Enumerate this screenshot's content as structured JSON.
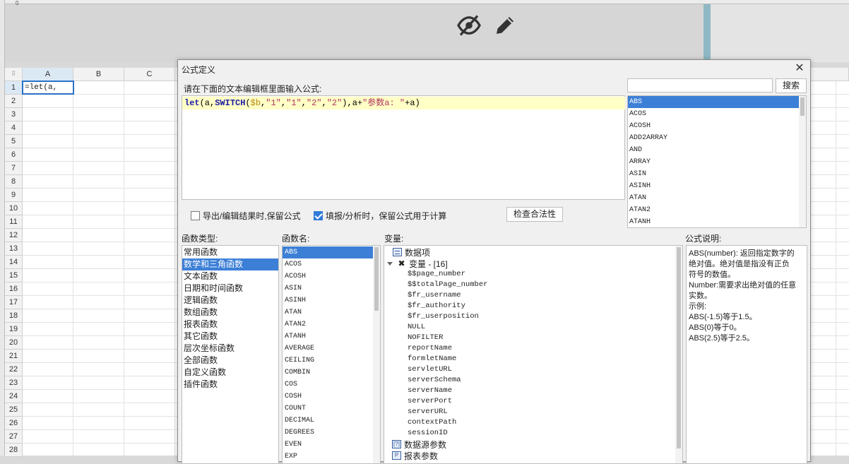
{
  "spreadsheet": {
    "columns": [
      "A",
      "B",
      "C"
    ],
    "rows": [
      "1",
      "2",
      "3",
      "4",
      "5",
      "6",
      "7",
      "8",
      "9",
      "10",
      "11",
      "12",
      "13",
      "14",
      "15",
      "16",
      "17",
      "18",
      "19",
      "20",
      "21",
      "22",
      "23",
      "24",
      "25",
      "26",
      "27",
      "28"
    ],
    "ruler_zero": "0",
    "cell_a1_value": "=let(a,"
  },
  "band_icons": [
    "eye-off-icon",
    "pencil-icon"
  ],
  "dialog": {
    "title": "公式定义",
    "prompt": "请在下面的文本编辑框里面输入公式:",
    "formula_tokens": [
      {
        "t": "let",
        "k": "kw"
      },
      {
        "t": "(a,",
        "k": "plain"
      },
      {
        "t": "SWITCH",
        "k": "kw"
      },
      {
        "t": "(",
        "k": "plain"
      },
      {
        "t": "$b",
        "k": "var"
      },
      {
        "t": ",",
        "k": "plain"
      },
      {
        "t": "\"1\"",
        "k": "str"
      },
      {
        "t": ",",
        "k": "plain"
      },
      {
        "t": "\"1\"",
        "k": "str"
      },
      {
        "t": ",",
        "k": "plain"
      },
      {
        "t": "\"2\"",
        "k": "str"
      },
      {
        "t": ",",
        "k": "plain"
      },
      {
        "t": "\"2\"",
        "k": "str"
      },
      {
        "t": "),a+",
        "k": "plain"
      },
      {
        "t": "\"参数a: \"",
        "k": "str"
      },
      {
        "t": "+a)",
        "k": "plain"
      }
    ],
    "search_placeholder": "",
    "search_button": "搜索",
    "top_function_list": [
      "ABS",
      "ACOS",
      "ACOSH",
      "ADD2ARRAY",
      "AND",
      "ARRAY",
      "ASIN",
      "ASINH",
      "ATAN",
      "ATAN2",
      "ATANH"
    ],
    "top_function_selected": "ABS",
    "checkbox_export": {
      "label": "导出/编辑结果时,保留公式",
      "checked": false
    },
    "checkbox_fill": {
      "label": "填报/分析时，保留公式用于计算",
      "checked": true
    },
    "validate_button": "检查合法性",
    "labels": {
      "function_type": "函数类型:",
      "function_name": "函数名:",
      "variables": "变量:",
      "description": "公式说明:"
    },
    "function_types": [
      "常用函数",
      "数学和三角函数",
      "文本函数",
      "日期和时间函数",
      "逻辑函数",
      "数组函数",
      "报表函数",
      "其它函数",
      "层次坐标函数",
      "全部函数",
      "自定义函数",
      "插件函数"
    ],
    "function_type_selected": "数学和三角函数",
    "function_names": [
      "ABS",
      "ACOS",
      "ACOSH",
      "ASIN",
      "ASINH",
      "ATAN",
      "ATAN2",
      "ATANH",
      "AVERAGE",
      "CEILING",
      "COMBIN",
      "COS",
      "COSH",
      "COUNT",
      "DECIMAL",
      "DEGREES",
      "EVEN",
      "EXP"
    ],
    "function_name_selected": "ABS",
    "variable_tree": {
      "data_items": "数据项",
      "variables_group": "变量 - [16]",
      "variables": [
        "$$page_number",
        "$$totalPage_number",
        "$fr_username",
        "$fr_authority",
        "$fr_userposition",
        "NULL",
        "NOFILTER",
        "reportName",
        "formletName",
        "servletURL",
        "serverSchema",
        "serverName",
        "serverPort",
        "serverURL",
        "contextPath",
        "sessionID"
      ],
      "datasource_params": "数据源参数",
      "report_params": "报表参数"
    },
    "description_lines": [
      "ABS(number): 返回指定数字的",
      "绝对值。绝对值是指没有正负",
      "符号的数值。",
      "Number:需要求出绝对值的任意",
      "实数。",
      "示例:",
      "ABS(-1.5)等于1.5。",
      "ABS(0)等于0。",
      "ABS(2.5)等于2.5。"
    ]
  }
}
